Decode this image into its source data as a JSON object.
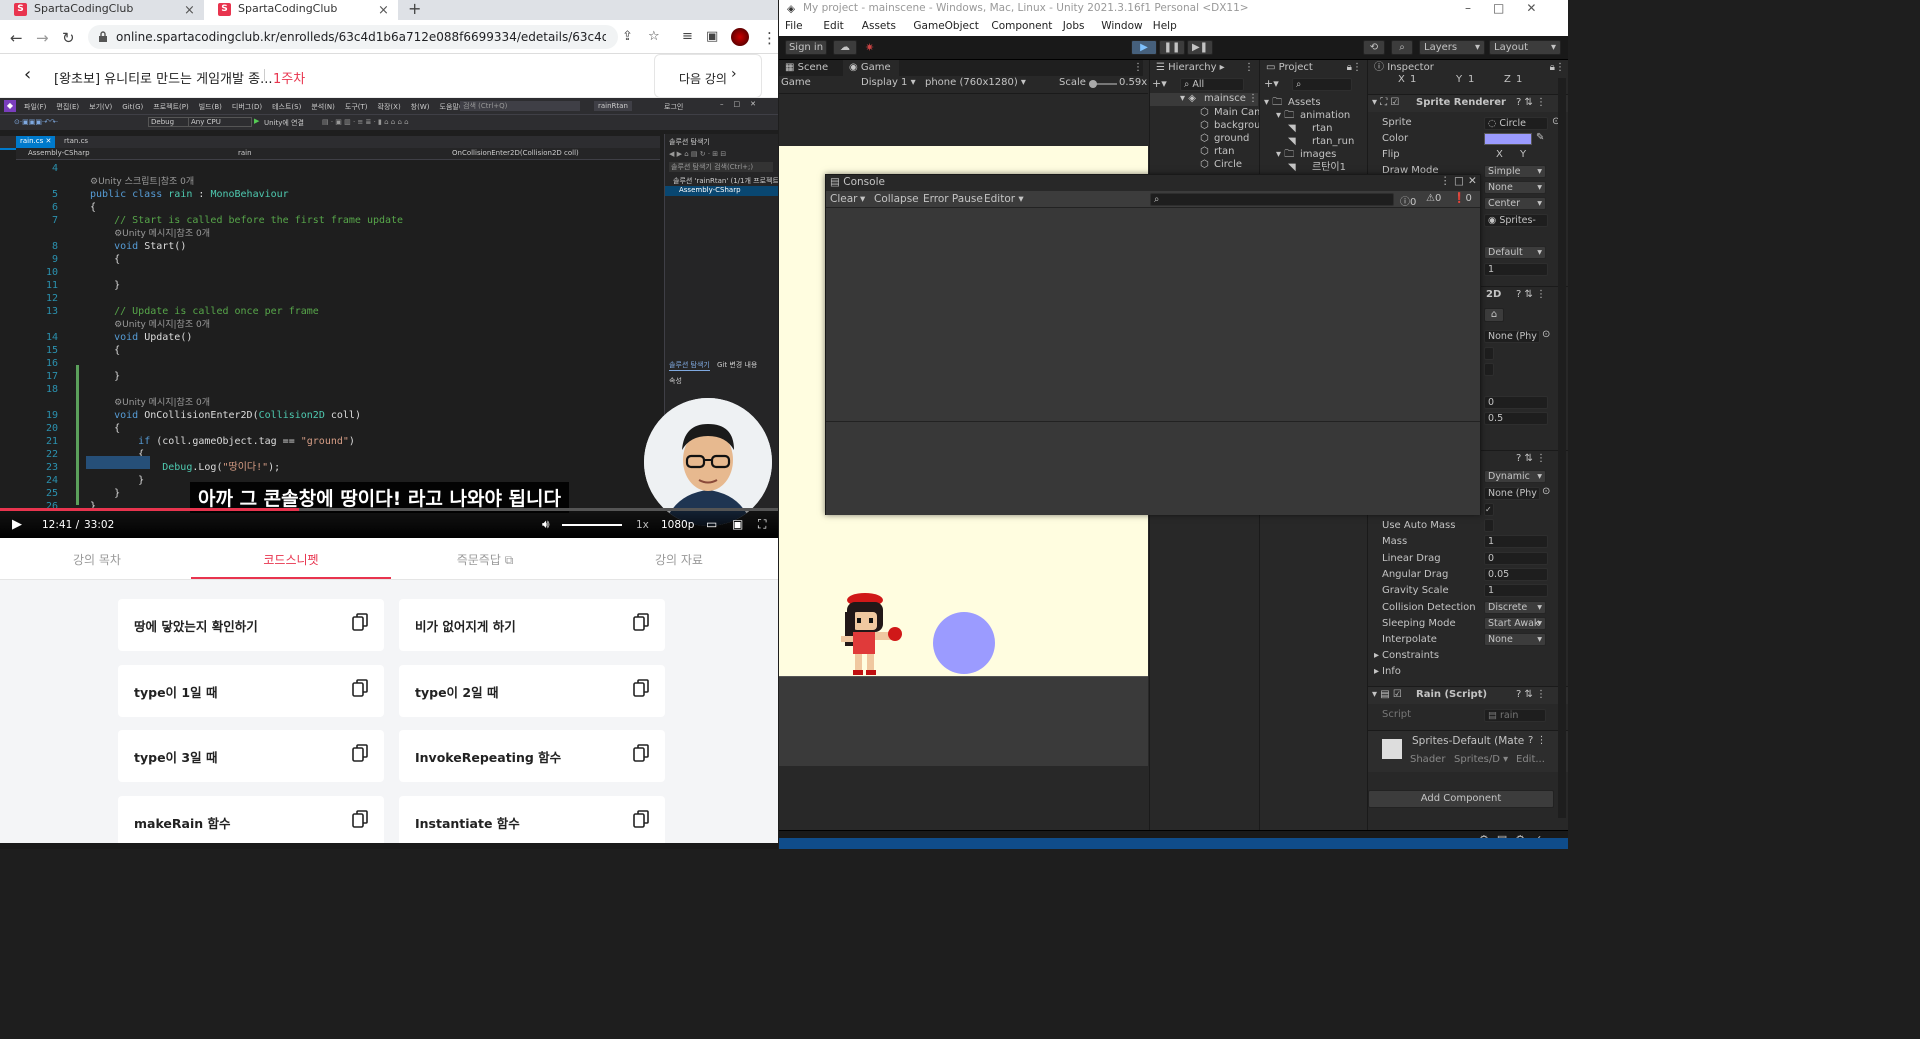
{
  "browser": {
    "tabs": [
      {
        "favicon": "S",
        "title": "SpartaCodingClub"
      },
      {
        "favicon": "S",
        "title": "SpartaCodingClub"
      }
    ],
    "url": "online.spartacodingclub.kr/enrolleds/63c4d1b6a712e088f6699334/edetails/63c4d1b6a712e08...",
    "course_title": "[왕초보] 유니티로 만드는 게임개발 종...",
    "week": "1주차",
    "next_button": "다음 강의"
  },
  "video": {
    "vs_menu": [
      "파일(F)",
      "편집(E)",
      "보기(V)",
      "Git(G)",
      "프로젝트(P)",
      "빌드(B)",
      "디버그(D)",
      "테스트(S)",
      "분석(N)",
      "도구(T)",
      "확장(X)",
      "창(W)",
      "도움말(H)"
    ],
    "vs_search_placeholder": "검색 (Ctrl+Q)",
    "vs_solution": "rainRtan",
    "vs_login": "로그인",
    "vs_config": "Debug",
    "vs_platform": "Any CPU",
    "vs_unity_attach": "Unity에 연결",
    "vs_file_tabs": [
      "rain.cs",
      "rtan.cs"
    ],
    "vs_nav": [
      "Assembly-CSharp",
      "rain",
      "OnCollisionEnter2D(Collision2D coll)"
    ],
    "solution_explorer_title": "솔루션 탐색기",
    "solution_search": "솔루션 탐색기 검색(Ctrl+;)",
    "solution_root": "솔루션 'rainRtan' (1/1개 프로젝트)",
    "solution_project": "Assembly-CSharp",
    "solution_tabs": [
      "솔루션 탐색기",
      "Git 변경 내용"
    ],
    "properties_title": "속성",
    "subtitle": "아까 그 콘솔창에 땅이다! 라고 나와야 됩니다",
    "time_current": "12:41 /",
    "time_total": "33:02",
    "speed": "1x",
    "quality": "1080p",
    "progress": 0.384
  },
  "code_lines": [
    {
      "n": "4",
      "html": ""
    },
    {
      "n": "",
      "html": "<span class='hint'>⚙Unity 스크립트|참조 0개</span>"
    },
    {
      "n": "5",
      "html": "<span class='kw'>public class</span> <span class='ty'>rain</span> : <span class='ty'>MonoBehaviour</span>"
    },
    {
      "n": "6",
      "html": "{"
    },
    {
      "n": "7",
      "html": "    <span class='cm'>// Start is called before the first frame update</span>"
    },
    {
      "n": "",
      "html": "    <span class='hint'>⚙Unity 메시지|참조 0개</span>"
    },
    {
      "n": "8",
      "html": "    <span class='kw'>void</span> Start()"
    },
    {
      "n": "9",
      "html": "    {"
    },
    {
      "n": "10",
      "html": ""
    },
    {
      "n": "11",
      "html": "    }"
    },
    {
      "n": "12",
      "html": ""
    },
    {
      "n": "13",
      "html": "    <span class='cm'>// Update is called once per frame</span>"
    },
    {
      "n": "",
      "html": "    <span class='hint'>⚙Unity 메시지|참조 0개</span>"
    },
    {
      "n": "14",
      "html": "    <span class='kw'>void</span> Update()"
    },
    {
      "n": "15",
      "html": "    {"
    },
    {
      "n": "16",
      "html": ""
    },
    {
      "n": "17",
      "html": "    }"
    },
    {
      "n": "18",
      "html": ""
    },
    {
      "n": "",
      "html": "    <span class='hint'>⚙Unity 메시지|참조 0개</span>"
    },
    {
      "n": "19",
      "html": "    <span class='kw'>void</span> OnCollisionEnter2D(<span class='ty'>Collision2D</span> coll)"
    },
    {
      "n": "20",
      "html": "    {"
    },
    {
      "n": "21",
      "html": "        <span class='kw'>if</span> (coll.gameObject.tag == <span class='st'>\"ground\"</span>)"
    },
    {
      "n": "22",
      "html": "        {"
    },
    {
      "n": "23",
      "html": "            <span class='ty'>Debug</span>.Log(<span class='st'>\"땅이다!\"</span>);"
    },
    {
      "n": "24",
      "html": "        }"
    },
    {
      "n": "25",
      "html": "    }"
    },
    {
      "n": "26",
      "html": "}"
    }
  ],
  "lecture_tabs": [
    {
      "label": "강의 목차",
      "active": false
    },
    {
      "label": "코드스니펫",
      "active": true
    },
    {
      "label": "즉문즉답",
      "active": false
    },
    {
      "label": "강의 자료",
      "active": false
    }
  ],
  "snippets": [
    "땅에 닿았는지 확인하기",
    "비가 없어지게 하기",
    "type이 1일 때",
    "type이 2일 때",
    "type이 3일 때",
    "InvokeRepeating 함수",
    "makeRain 함수",
    "Instantiate 함수"
  ],
  "unity": {
    "title": "My project - mainscene - Windows, Mac, Linux - Unity 2021.3.16f1 Personal <DX11>",
    "menu": [
      "File",
      "Edit",
      "Assets",
      "GameObject",
      "Component",
      "Jobs",
      "Window",
      "Help"
    ],
    "sign_in": "Sign in",
    "layers": "Layers",
    "layout": "Layout",
    "scene_tab": "Scene",
    "game_tab": "Game",
    "game_dropdown": "Game",
    "display": "Display 1",
    "resolution": "phone (760x1280)",
    "scale_label": "Scale",
    "scale_value": "0.59x",
    "hierarchy_tab": "Hierarchy",
    "hierarchy_search": "All",
    "hierarchy_scene": "mainsce",
    "hierarchy_items": [
      "Main Cam",
      "backgrou",
      "ground",
      "rtan",
      "Circle"
    ],
    "project_tab": "Project",
    "project_items": [
      {
        "name": "Assets",
        "indent": 0,
        "type": "folder"
      },
      {
        "name": "animation",
        "indent": 1,
        "type": "folder"
      },
      {
        "name": "rtan",
        "indent": 2,
        "type": "file"
      },
      {
        "name": "rtan_run",
        "indent": 2,
        "type": "file"
      },
      {
        "name": "images",
        "indent": 1,
        "type": "folder"
      },
      {
        "name": "르탄이1",
        "indent": 2,
        "type": "file"
      }
    ],
    "inspector_tab": "Inspector",
    "transform_xyz": [
      "X",
      "1",
      "Y",
      "1",
      "Z",
      "1"
    ],
    "sprite_renderer": {
      "title": "Sprite Renderer",
      "sprite_label": "Sprite",
      "sprite_value": "Circle",
      "color_label": "Color",
      "color_value": "#9b9bff",
      "flip_label": "Flip",
      "flip_x": "X",
      "flip_y": "Y",
      "draw_mode_label": "Draw Mode",
      "draw_mode": "Simple",
      "mask": "None",
      "sort_point": "Center",
      "material": "Sprites-",
      "sorting_layer": "Default",
      "order": "1"
    },
    "rb_header": "2D",
    "collider_material": "None (Phy",
    "offset_zero": "0",
    "radius": "0.5",
    "body_type": "Dynamic",
    "rb_material": "None (Phy",
    "rigidbody": [
      {
        "label": "Use Auto Mass",
        "value": "",
        "kind": "check"
      },
      {
        "label": "Mass",
        "value": "1",
        "kind": "field"
      },
      {
        "label": "Linear Drag",
        "value": "0",
        "kind": "field"
      },
      {
        "label": "Angular Drag",
        "value": "0.05",
        "kind": "field"
      },
      {
        "label": "Gravity Scale",
        "value": "1",
        "kind": "field"
      },
      {
        "label": "Collision Detection",
        "value": "Discrete",
        "kind": "dd"
      },
      {
        "label": "Sleeping Mode",
        "value": "Start Awak",
        "kind": "dd"
      },
      {
        "label": "Interpolate",
        "value": "None",
        "kind": "dd"
      }
    ],
    "constraints": "Constraints",
    "info": "Info",
    "rain_script": {
      "title": "Rain (Script)",
      "script_label": "Script",
      "script_value": "rain"
    },
    "material_name": "Sprites-Default (Mate",
    "shader_label": "Shader",
    "shader_value": "Sprites/D",
    "edit": "Edit...",
    "add_component": "Add Component",
    "console": {
      "title": "Console",
      "buttons": [
        "Clear",
        "Collapse",
        "Error Pause",
        "Editor"
      ],
      "counts": [
        "0",
        "0",
        "0"
      ]
    },
    "circle_color": "#9b9bff",
    "bg_color": "#fffde0",
    "ground_color": "#3a3a3a"
  }
}
